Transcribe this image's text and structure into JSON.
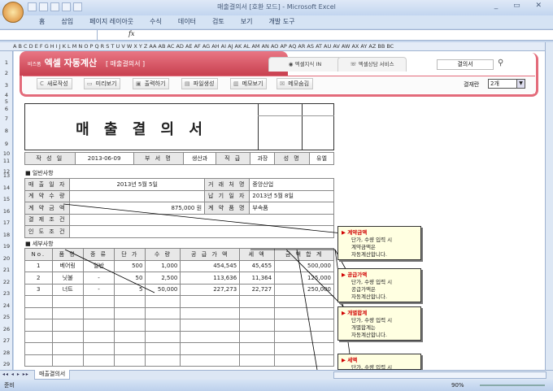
{
  "window": {
    "title": "매출결의서 [호환 모드] - Microsoft Excel"
  },
  "ribbon_tabs": [
    "홈",
    "삽입",
    "페이지 레이아웃",
    "수식",
    "데이터",
    "검토",
    "보기",
    "개발 도구"
  ],
  "formula": {
    "fx": "fx"
  },
  "columns": "A B C D E F G H I J K L M N O P Q R S T U V W X Y Z AA AB AC AD AE AF AG AH AI AJ AK AL AM AN AO AP AQ AR AS AT AU AV AW AX AY AZ BB BC",
  "rows": [
    "1",
    "2",
    "3",
    "4",
    "5",
    "6",
    "7",
    "8",
    "9",
    "10",
    "11",
    "12",
    "13",
    "14",
    "15",
    "16",
    "17",
    "18",
    "19",
    "20",
    "21",
    "22",
    "23",
    "24",
    "25",
    "26",
    "27",
    "28",
    "29"
  ],
  "banner": {
    "brand_small": "비즈폼",
    "brand": "엑셀 자동계산",
    "doc": "[ 매출결의서 ]",
    "tab1": "엑셀지식 IN",
    "tab2": "엑셀상담 서비스",
    "search": "결의서",
    "buttons": [
      "새로작성",
      "미리보기",
      "출력하기",
      "파일생성",
      "메모보기",
      "메모숨김"
    ],
    "approve_label": "결재란",
    "approve_value": "2개"
  },
  "doc": {
    "title": "매 출 결 의 서",
    "info": {
      "l1": "작 성 일",
      "v1": "2013-06-09",
      "l2": "부 서 명",
      "v2": "생산과",
      "l3": "직 급",
      "v3": "과장",
      "l4": "성 명",
      "v4": "유엘"
    },
    "general_title": "■ 일반사항",
    "general": [
      [
        "매 출 일 자",
        "2013년 5월 5일",
        "거 래 처 명",
        "중앙산업"
      ],
      [
        "계 약 수 량",
        "",
        "납 기 일 자",
        "2013년 5월 8일"
      ],
      [
        "계 약 금 액",
        "875,000 원",
        "계 약 품 명",
        "부속품"
      ],
      [
        "결 제 조 건",
        "",
        "",
        ""
      ],
      [
        "인 도 조 건",
        "",
        "",
        ""
      ]
    ],
    "detail_title": "■ 세부사항",
    "headers": [
      "No.",
      "품  명",
      "종  류",
      "단  가",
      "수  량",
      "공 급 가 액",
      "세  액",
      "금 액 합 계"
    ],
    "items": [
      [
        "1",
        "베어링",
        "일반",
        "500",
        "1,000",
        "454,545",
        "45,455",
        "500,000"
      ],
      [
        "2",
        "닛불",
        "-",
        "50",
        "2,500",
        "113,636",
        "11,364",
        "125,000"
      ],
      [
        "3",
        "너트",
        "-",
        "5",
        "50,000",
        "227,273",
        "22,727",
        "250,000"
      ]
    ]
  },
  "memos": [
    {
      "title": "계약금액",
      "lines": [
        "단가, 수량 입력 시",
        "계약금액은",
        "자동계산합니다."
      ]
    },
    {
      "title": "공급가액",
      "lines": [
        "단가, 수량 입력 시",
        "공급가액은",
        "자동계산합니다."
      ]
    },
    {
      "title": "개별합계",
      "lines": [
        "단가, 수량 입력 시",
        "개별합계는",
        "자동계산합니다."
      ]
    },
    {
      "title": "세액",
      "lines": [
        "단가, 수량 입력 시"
      ]
    }
  ],
  "sheet_tab": "매출결의서",
  "status": {
    "ready": "준비",
    "zoom": "90%"
  }
}
